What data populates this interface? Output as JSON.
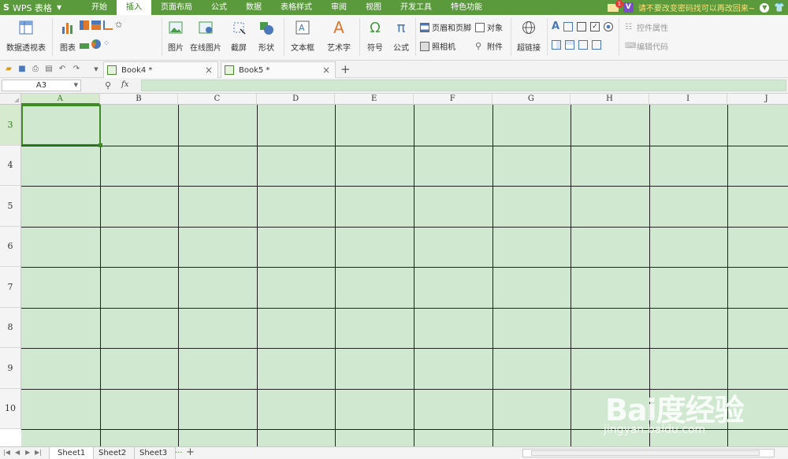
{
  "app": {
    "logo": "S",
    "name": "WPS 表格",
    "caret": "▼"
  },
  "menu": {
    "tabs": [
      "开始",
      "插入",
      "页面布局",
      "公式",
      "数据",
      "表格样式",
      "审阅",
      "视图",
      "开发工具",
      "特色功能"
    ],
    "active": "插入"
  },
  "title_right": {
    "mail_badge": "1",
    "v_badge": "V",
    "notice": "请不要改变密码找可以再改回来~"
  },
  "ribbon": {
    "pivot": "数据透视表",
    "chart": "图表",
    "picture": "图片",
    "online_picture": "在线图片",
    "screenshot": "截屏",
    "shape": "形状",
    "textbox": "文本框",
    "wordart": "艺术字",
    "symbol": "符号",
    "formula": "公式",
    "header_footer": "页眉和页脚",
    "object": "对象",
    "camera": "照相机",
    "attachment": "附件",
    "hyperlink": "超链接",
    "control_props": "控件属性",
    "edit_code": "编辑代码"
  },
  "doc_tabs": [
    {
      "label": "Book4 *",
      "close": "×"
    },
    {
      "label": "Book5 *",
      "close": "×"
    }
  ],
  "new_tab": "+",
  "formula_bar": {
    "name_box": "A3",
    "fx": "fx",
    "value": ""
  },
  "columns": [
    "A",
    "B",
    "C",
    "D",
    "E",
    "F",
    "G",
    "H",
    "I",
    "J"
  ],
  "rows": [
    "3",
    "4",
    "5",
    "6",
    "7",
    "8",
    "9",
    "10"
  ],
  "selected_cell": "A3",
  "sheets": [
    "Sheet1",
    "Sheet2",
    "Sheet3"
  ],
  "active_sheet": "Sheet1",
  "sheet_more": "···",
  "sheet_add": "+",
  "colors": {
    "brand": "#5a9a3c",
    "grid_bg": "#cfe8cf",
    "selection": "#3e8a24"
  },
  "watermark": {
    "logo": "Bai度经验",
    "url": "jingyan.baidu.com"
  }
}
